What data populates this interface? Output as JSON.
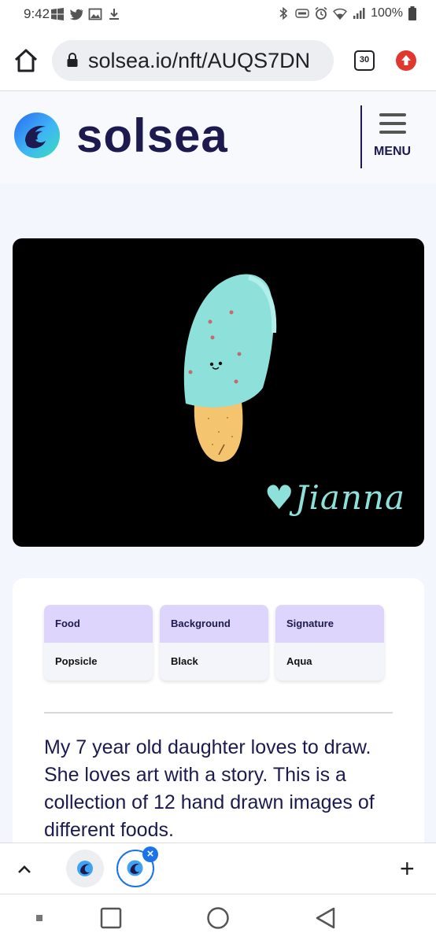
{
  "status_bar": {
    "time": "9:42",
    "battery": "100%",
    "icons": [
      "windows-icon",
      "twitter-icon",
      "image-icon",
      "download-icon",
      "bluetooth-icon",
      "volte-icon",
      "alarm-icon",
      "wifi-icon",
      "signal-icon",
      "battery-icon"
    ]
  },
  "browser": {
    "url": "solsea.io/nft/AUQS7DN",
    "tab_count": "30"
  },
  "site": {
    "brand": "solsea",
    "menu_label": "MENU"
  },
  "nft": {
    "signature_text": "♥Jianna",
    "attributes": [
      {
        "trait": "Food",
        "value": "Popsicle"
      },
      {
        "trait": "Background",
        "value": "Black"
      },
      {
        "trait": "Signature",
        "value": "Aqua"
      }
    ],
    "description": "My 7 year old daughter loves to draw. She loves art with a story. This is a collection of 12 hand drawn images of different foods."
  },
  "tab_strip": {
    "new_tab_symbol": "+",
    "close_symbol": "×"
  },
  "colors": {
    "brand_navy": "#1c1a4e",
    "attribute_header": "#ddd5fb",
    "popsicle_aqua": "#8ee0da",
    "popsicle_stick": "#f5c46e",
    "chrome_blue": "#1a73e8",
    "update_red": "#e2372e"
  }
}
